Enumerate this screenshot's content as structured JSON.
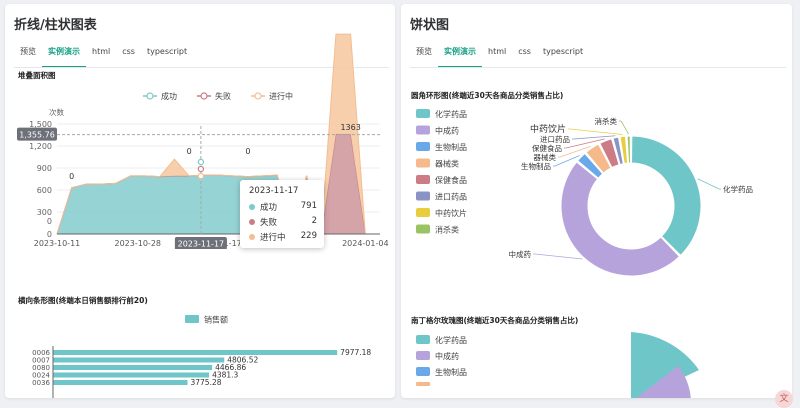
{
  "left": {
    "title": "折线/柱状图表",
    "tabs": [
      "预览",
      "实例演示",
      "html",
      "css",
      "typescript"
    ],
    "active_tab": 1,
    "area_chart_title": "堆叠面积图",
    "bar_chart_title": "横向条形图(终端本日销售额排行前20)"
  },
  "right": {
    "title": "饼状图",
    "tabs": [
      "预览",
      "实例演示",
      "html",
      "css",
      "typescript"
    ],
    "active_tab": 1,
    "donut_title": "圆角环形图(终端近30天各商品分类销售占比)",
    "rose_title": "南丁格尔玫瑰图(终端近30天各商品分类销售占比)"
  },
  "tooltip": {
    "date": "2023-11-17",
    "rows": [
      {
        "name": "成功",
        "value": "791",
        "color": "#7ec9cc"
      },
      {
        "name": "失败",
        "value": "2",
        "color": "#c77f86"
      },
      {
        "name": "进行中",
        "value": "229",
        "color": "#f3be92"
      }
    ]
  },
  "colors": {
    "accent": "#16a085",
    "success": "#7ec9cc",
    "fail": "#c77f86",
    "progress": "#f3be92"
  },
  "chart_data": [
    {
      "type": "area",
      "title": "堆叠面积图",
      "ylabel": "次数",
      "ylim": [
        0,
        1500
      ],
      "yticks": [
        "0",
        "300",
        "600",
        "900",
        "1,200",
        "1,500"
      ],
      "extra_ytick": "0",
      "x_ticks": [
        "2023-10-11",
        "2023-10-28",
        "2023-11-17",
        "2023-12-",
        "2024-01-04"
      ],
      "legend": [
        "成功",
        "失败",
        "进行中"
      ],
      "legend_position": "top-center",
      "axis_pointer_y": "1,355.76",
      "axis_pointer_x": "2023-11-17",
      "data_labels": [
        {
          "series": "成功",
          "index": 1,
          "text": "0"
        },
        {
          "series": "成功",
          "index": 9,
          "text": "0"
        },
        {
          "series": "成功",
          "index": 13,
          "text": "0"
        },
        {
          "series": "进行中",
          "index": 20,
          "text": "1363"
        }
      ],
      "x": [
        0,
        1,
        2,
        3,
        4,
        5,
        6,
        7,
        8,
        9,
        10,
        11,
        12,
        13,
        14,
        15,
        16,
        17,
        18,
        19,
        20,
        21,
        22
      ],
      "series": [
        {
          "name": "成功",
          "values": [
            0,
            630,
            680,
            680,
            690,
            790,
            790,
            780,
            790,
            790,
            800,
            800,
            790,
            780,
            790,
            800,
            0,
            790,
            0,
            0,
            0,
            0,
            0
          ]
        },
        {
          "name": "失败",
          "values": [
            0,
            0,
            0,
            0,
            0,
            2,
            2,
            2,
            2,
            2,
            2,
            2,
            2,
            2,
            2,
            2,
            0,
            2,
            0,
            1363,
            1363,
            0,
            0
          ]
        },
        {
          "name": "进行中",
          "values": [
            0,
            0,
            0,
            0,
            0,
            0,
            0,
            0,
            229,
            0,
            0,
            0,
            0,
            0,
            0,
            0,
            0,
            0,
            0,
            1363,
            1363,
            0,
            0
          ]
        }
      ]
    },
    {
      "type": "bar",
      "title": "横向条形图(终端本日销售额排行前20)",
      "legend": [
        "销售额"
      ],
      "categories": [
        "0006",
        "0007",
        "0080",
        "0024",
        "0036"
      ],
      "values": [
        7977.18,
        4806.52,
        4466.86,
        4381.3,
        3775.28
      ],
      "value_labels": [
        "7977.18",
        "4806.52",
        "4466.86",
        "4381.3",
        "3775.28"
      ]
    },
    {
      "type": "pie",
      "title": "圆角环形图(终端近30天各商品分类销售占比)",
      "legend_position": "left",
      "categories": [
        "化学药品",
        "中成药",
        "生物制品",
        "器械类",
        "保健食品",
        "进口药品",
        "中药饮片",
        "消杀类"
      ],
      "values": [
        35,
        45,
        2.5,
        3.5,
        3,
        1.5,
        1.5,
        1
      ],
      "colors": [
        "#6fc6c8",
        "#b6a3dc",
        "#6aa9e9",
        "#f6b98b",
        "#cb7c86",
        "#8a93c6",
        "#e8ce3e",
        "#9ac464"
      ],
      "label_texts": [
        "化学药品",
        "中成药",
        "生物制品",
        "器械类",
        "保健食品",
        "进口药品",
        "中药饮片",
        "消杀类"
      ]
    },
    {
      "type": "pie",
      "title": "南丁格尔玫瑰图(终端近30天各商品分类销售占比)",
      "legend_position": "left",
      "categories": [
        "化学药品",
        "中成药",
        "生物制品"
      ],
      "colors": [
        "#6fc6c8",
        "#b6a3dc",
        "#6aa9e9"
      ]
    }
  ]
}
